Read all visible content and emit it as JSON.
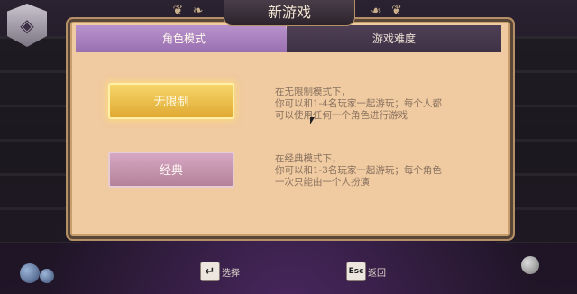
{
  "title": "新游戏",
  "tabs": [
    {
      "label": "角色模式"
    },
    {
      "label": "游戏难度"
    }
  ],
  "modes": [
    {
      "label": "无限制",
      "description": "在无限制模式下，\n你可以和1-4名玩家一起游玩；每个人都\n可以使用任何一个角色进行游戏"
    },
    {
      "label": "经典",
      "description": "在经典模式下，\n你可以和1-3名玩家一起游玩；每个角色\n一次只能由一个人扮演"
    }
  ],
  "controls": {
    "select_key": "↵",
    "select_label": "选择",
    "back_key": "Esc",
    "back_label": "返回"
  },
  "colors": {
    "panel": "#f0caa0",
    "active_tab": "#b892cc",
    "selected_button": "#f6d56a",
    "classic_button": "#d6a7c4"
  }
}
